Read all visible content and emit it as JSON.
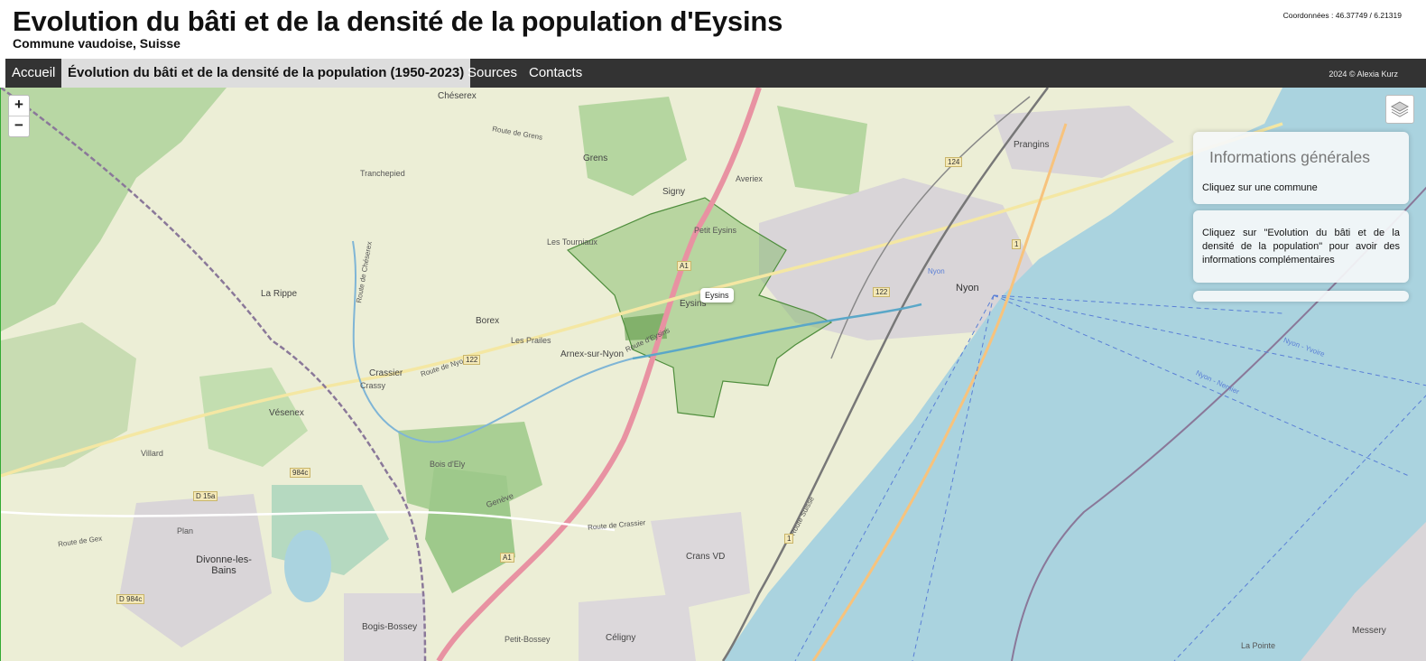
{
  "header": {
    "title": "Evolution du bâti et de la densité de la population d'Eysins",
    "subtitle": "Commune vaudoise, Suisse",
    "coordinates": "Coordonnées : 46.37749 / 6.21319"
  },
  "nav": {
    "items": [
      {
        "label": "Accueil"
      },
      {
        "label": "Évolution du bâti et de la densité de la population (1950-2023)"
      },
      {
        "label": "Sources"
      },
      {
        "label": "Contacts"
      }
    ],
    "copyright": "2024 © Alexia Kurz"
  },
  "map": {
    "zoom_in": "+",
    "zoom_out": "−",
    "layers_icon": "layers-icon",
    "tooltip": "Eysins",
    "colors": {
      "land": "#e8ebd3",
      "water": "#aad3df",
      "forest": "#add19e",
      "highway": "#e892a2",
      "commune": "#5fa64b"
    },
    "labels": {
      "chéserex": "Chéserex",
      "grens": "Grens",
      "signy": "Signy",
      "prangins": "Prangins",
      "tranchepied": "Tranchepied",
      "petit_eysins": "Petit Eysins",
      "les_tourniaux": "Les Tourniaux",
      "la_rippe": "La Rippe",
      "borex": "Borex",
      "les_prailes": "Les Prailes",
      "arnex": "Arnex-sur-Nyon",
      "eysins": "Eysins",
      "nyon": "Nyon",
      "nyon_station": "Nyon",
      "crassier": "Crassier",
      "crassy": "Crassy",
      "vesenex": "Vésenex",
      "villard": "Villard",
      "bois_ely": "Bois d'Ely",
      "plan": "Plan",
      "divonne": "Divonne-les-Bains",
      "crans": "Crans VD",
      "bogis": "Bogis-Bossey",
      "petit_bossey": "Petit-Bossey",
      "celigny": "Céligny",
      "messery": "Messery",
      "la_pointe": "La Pointe",
      "averiex": "Averiex",
      "nyon_yvoire": "Nyon - Yvoire",
      "nyon_nernier": "Nyon - Nernier",
      "geneve": "Genève",
      "route_grens": "Route de Grens",
      "route_nyon": "Route de Nyon",
      "rue_suisse": "Route Suisse",
      "route_crassier": "Route de Crassier",
      "route_eysins": "Route d'Eysins",
      "route_gex": "Route de Gex",
      "route_cheserex": "Route de Chéserex"
    },
    "road_badges": [
      "A1",
      "A1",
      "122",
      "122",
      "124",
      "1",
      "1",
      "D 15a",
      "D 984c",
      "984c"
    ]
  },
  "panels": {
    "info_title": "Informations générales",
    "info_text": "Cliquez sur une commune",
    "help_text": "Cliquez sur \"Evolution du bâti et de la densité de la population\" pour avoir des informations complémentaires"
  }
}
